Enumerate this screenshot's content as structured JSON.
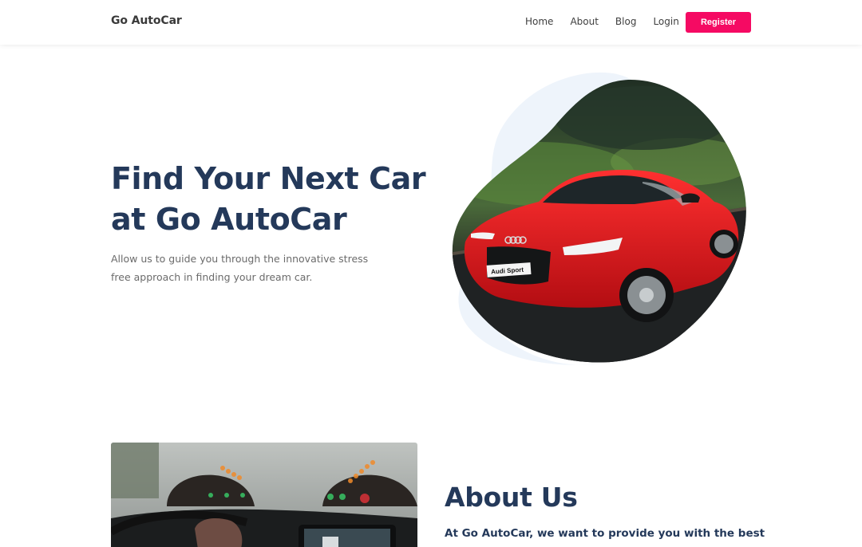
{
  "header": {
    "brand": "Go AutoCar",
    "nav": [
      {
        "label": "Home"
      },
      {
        "label": "About"
      },
      {
        "label": "Blog"
      },
      {
        "label": "Login"
      }
    ],
    "register_label": "Register"
  },
  "hero": {
    "title_line1": "Find Your Next Car",
    "title_line2": "at Go AutoCar",
    "description": "Allow us to guide you through the innovative stress free approach in finding your dream car.",
    "car_plate": "Audi Sport"
  },
  "about": {
    "title": "About Us",
    "lead": "At Go AutoCar, we want to provide you with the best"
  },
  "colors": {
    "accent": "#f50a63",
    "heading": "#24395a",
    "body_text": "#6b6b6b",
    "blob_background": "#eef4fb"
  }
}
